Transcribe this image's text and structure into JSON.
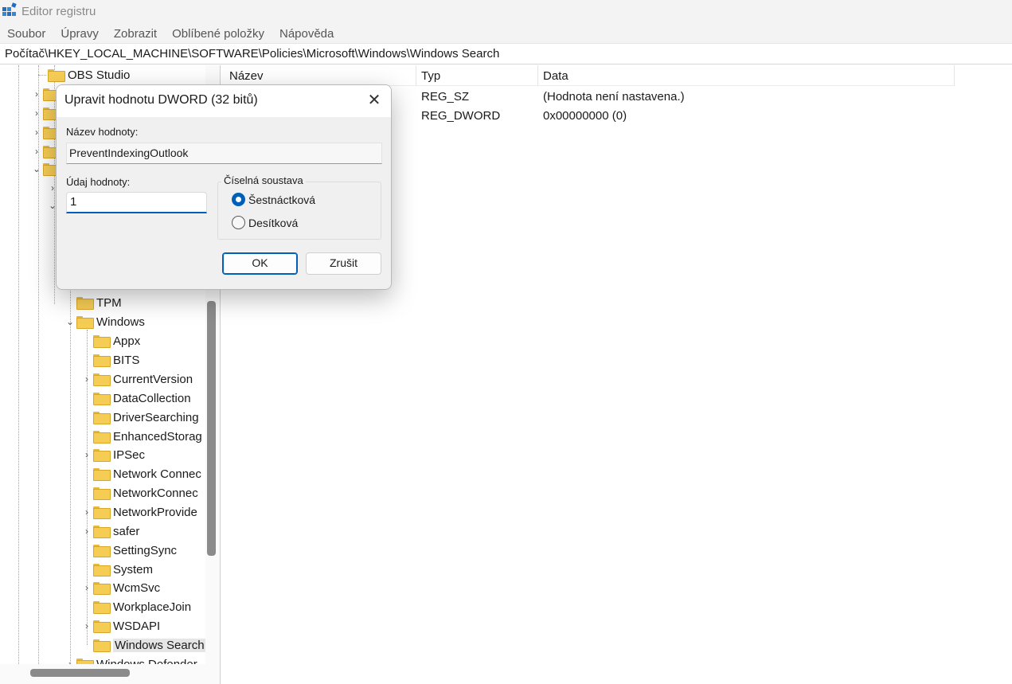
{
  "window": {
    "title": "Editor registru",
    "icon": "registry-editor-icon",
    "accent": "#005fb8"
  },
  "menu": [
    "Soubor",
    "Úpravy",
    "Zobrazit",
    "Oblíbené položky",
    "Nápověda"
  ],
  "address": "Počítač\\HKEY_LOCAL_MACHINE\\SOFTWARE\\Policies\\Microsoft\\Windows\\Windows Search",
  "tree": {
    "top_item": "OBS Studio",
    "items": [
      {
        "label": "TPM",
        "expandable": false
      },
      {
        "label": "Windows",
        "expandable": true,
        "expanded": true
      },
      {
        "label": "Appx",
        "expandable": false
      },
      {
        "label": "BITS",
        "expandable": false
      },
      {
        "label": "CurrentVersion",
        "expandable": true
      },
      {
        "label": "DataCollection",
        "expandable": false
      },
      {
        "label": "DriverSearching",
        "expandable": false
      },
      {
        "label": "EnhancedStorag",
        "expandable": false
      },
      {
        "label": "IPSec",
        "expandable": true
      },
      {
        "label": "Network Connec",
        "expandable": false
      },
      {
        "label": "NetworkConnec",
        "expandable": false
      },
      {
        "label": "NetworkProvide",
        "expandable": true
      },
      {
        "label": "safer",
        "expandable": true
      },
      {
        "label": "SettingSync",
        "expandable": false
      },
      {
        "label": "System",
        "expandable": false
      },
      {
        "label": "WcmSvc",
        "expandable": true
      },
      {
        "label": "WorkplaceJoin",
        "expandable": false
      },
      {
        "label": "WSDAPI",
        "expandable": true
      },
      {
        "label": "Windows Search",
        "expandable": false,
        "selected": true
      },
      {
        "label": "Windows Defender",
        "expandable": true
      }
    ]
  },
  "list": {
    "columns": [
      "Název",
      "Typ",
      "Data"
    ],
    "rows": [
      {
        "name": "",
        "type": "REG_SZ",
        "data": "(Hodnota není nastavena.)"
      },
      {
        "name": "",
        "type": "REG_DWORD",
        "data": "0x00000000 (0)"
      }
    ]
  },
  "dialog": {
    "title": "Upravit hodnotu DWORD (32 bitů)",
    "name_label": "Název hodnoty:",
    "name_value": "PreventIndexingOutlook",
    "data_label": "Údaj hodnoty:",
    "data_value": "1",
    "base_label": "Číselná soustava",
    "base_options": [
      {
        "label": "Šestnáctková",
        "selected": true
      },
      {
        "label": "Desítková",
        "selected": false
      }
    ],
    "ok_label": "OK",
    "cancel_label": "Zrušit"
  }
}
